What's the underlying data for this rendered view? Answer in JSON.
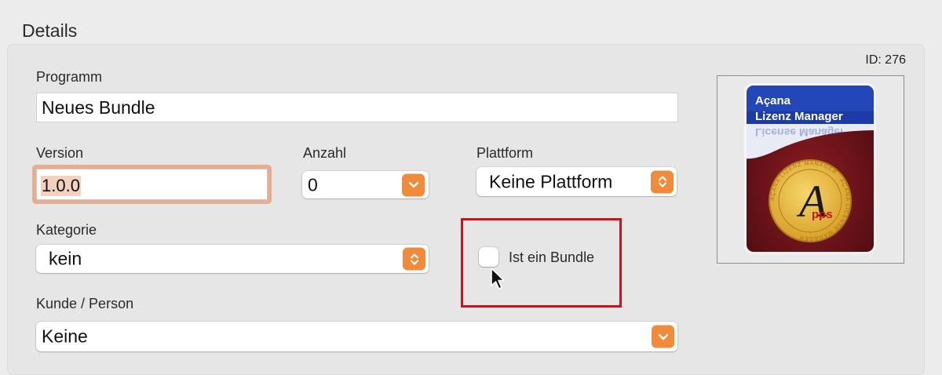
{
  "section": {
    "title": "Details"
  },
  "record": {
    "id_label": "ID: 276"
  },
  "fields": {
    "programm": {
      "label": "Programm",
      "value": "Neues Bundle"
    },
    "version": {
      "label": "Version",
      "value": "1.0.0"
    },
    "anzahl": {
      "label": "Anzahl",
      "value": "0"
    },
    "plattform": {
      "label": "Plattform",
      "value": "Keine Plattform"
    },
    "kategorie": {
      "label": "Kategorie",
      "value": "kein"
    },
    "bundle": {
      "label": "Ist ein Bundle",
      "checked": false
    },
    "kunde": {
      "label": "Kunde / Person",
      "value": "Keine"
    }
  },
  "app_icon": {
    "title_line1": "Açana",
    "title_line2": "Lizenz Manager",
    "reflection": "License Manager",
    "seal_text": "AÇANA LIZENZ MANAGER · AÇANA LICENSE MANAGER",
    "seal_letter": "A",
    "seal_word": "pps"
  },
  "colors": {
    "accent_orange": "#ef8b3a",
    "focus_ring": "#e5a98a",
    "annotation_red": "#d0111a",
    "icon_blue": "#2346b8",
    "icon_maroon": "#6e1419",
    "seal_gold": "#e8b93a"
  },
  "icons": {
    "stepper": "chevron-up-down-icon",
    "dropdown": "chevron-down-icon",
    "cursor": "mouse-pointer-icon"
  }
}
